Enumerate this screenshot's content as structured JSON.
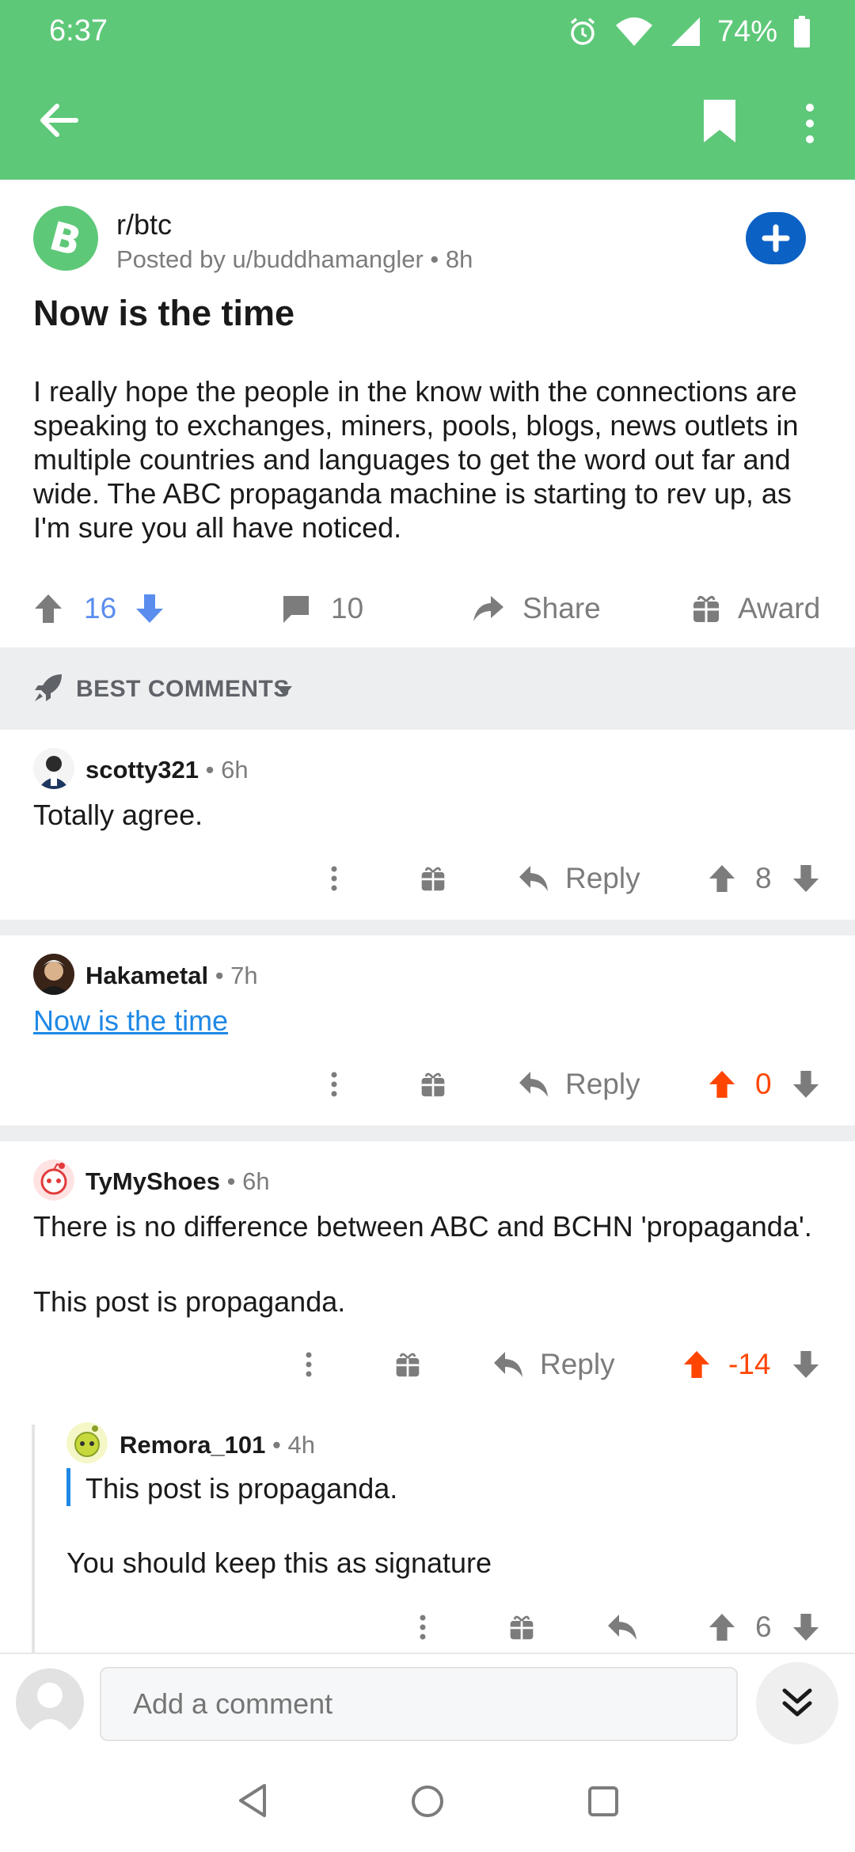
{
  "status": {
    "time": "6:37",
    "battery": "74%"
  },
  "post": {
    "subreddit": "r/btc",
    "posted_by": "Posted by u/buddhamangler • 8h",
    "title": "Now is the time",
    "body": "I really hope the people in the know with the connections are speaking to exchanges, miners, pools, blogs, news outlets in multiple countries and languages to get the word out far and wide.  The ABC propaganda machine is starting to rev up, as I'm sure you all have noticed.",
    "score": "16",
    "comments": "10",
    "share_label": "Share",
    "award_label": "Award"
  },
  "sort": {
    "label": "BEST COMMENTS"
  },
  "comments": [
    {
      "author": "scotty321",
      "time": "• 6h",
      "text": "Totally agree.",
      "reply_label": "Reply",
      "score": "8"
    },
    {
      "author": "Hakametal",
      "time": "• 7h",
      "text": "Now is the time",
      "reply_label": "Reply",
      "score": "0"
    },
    {
      "author": "TyMyShoes",
      "time": "• 6h",
      "text": "There is no difference between ABC and BCHN 'propaganda'.",
      "text2": "This post is propaganda.",
      "reply_label": "Reply",
      "score": "-14"
    },
    {
      "author": "Remora_101",
      "time": "• 4h",
      "quote": "This post is propaganda.",
      "text": "You should keep this as signature",
      "score": "6"
    }
  ],
  "composer": {
    "placeholder": "Add a comment"
  },
  "colors": {
    "header_green": "#5ec879",
    "accent_blue": "#0c62c4",
    "upvote_orange": "#ff4500",
    "link_blue": "#1e88e5"
  },
  "icons": [
    "back-arrow-icon",
    "bookmark-icon",
    "more-vertical-icon",
    "bitcoin-cash-icon",
    "plus-icon",
    "upvote-icon",
    "downvote-icon",
    "comment-icon",
    "share-icon",
    "gift-icon",
    "rocket-icon",
    "reply-icon",
    "chevron-double-down-icon"
  ]
}
